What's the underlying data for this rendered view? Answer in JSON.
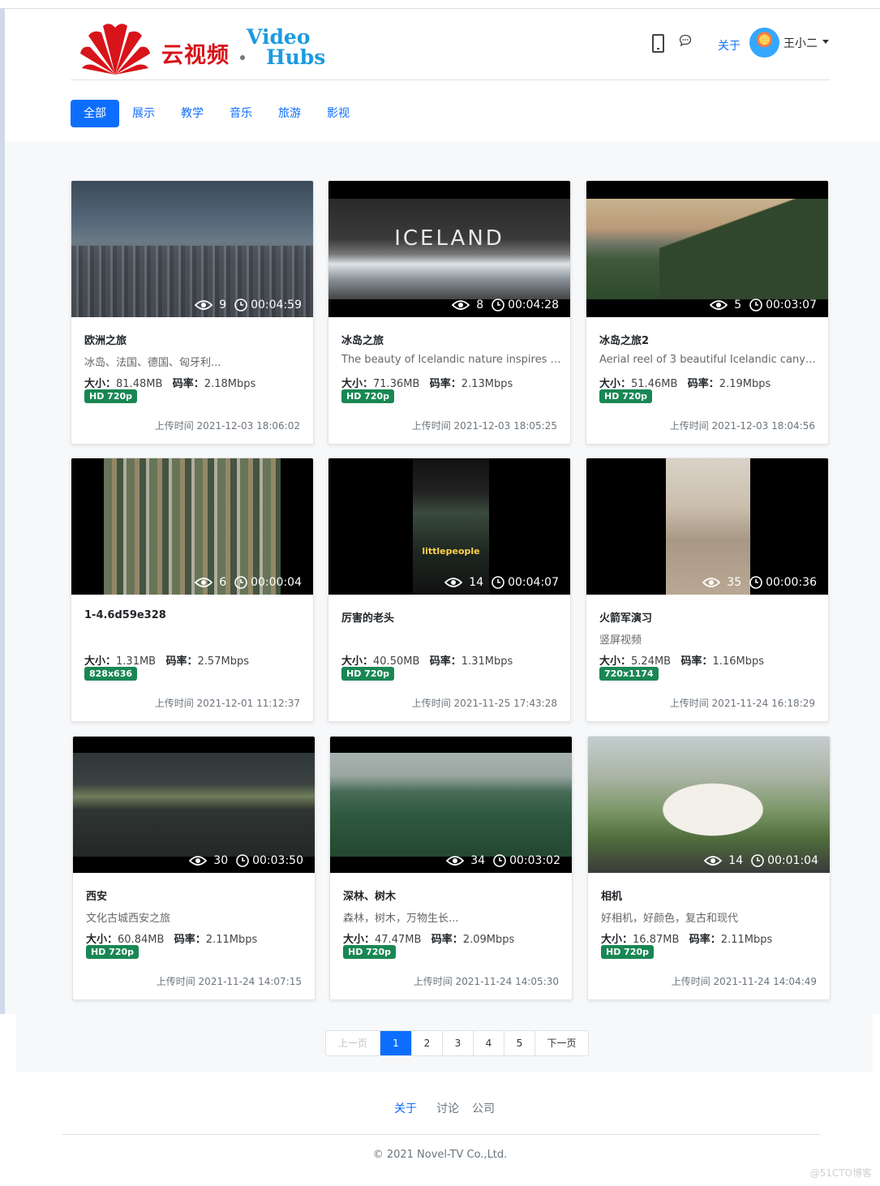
{
  "header": {
    "logo_cn": "云视频",
    "logo_en_line1": "Video",
    "logo_en_line2": "Hubs",
    "about_label": "关于",
    "user_name": "王小二"
  },
  "tabs": [
    {
      "label": "全部",
      "active": true
    },
    {
      "label": "展示"
    },
    {
      "label": "教学"
    },
    {
      "label": "音乐"
    },
    {
      "label": "旅游"
    },
    {
      "label": "影视"
    }
  ],
  "size_label": "大小：",
  "bitrate_label": "码率：",
  "upload_prefix": "上传时间",
  "videos": [
    {
      "title": "欧洲之旅",
      "desc": "冰岛、法国、德国、匈牙利...",
      "views": "9",
      "duration": "00:04:59",
      "size": "81.48MB",
      "bitrate": "2.18Mbps",
      "resolution": "HD 720p",
      "uploaded": "2021-12-03 18:06:02"
    },
    {
      "title": "冰岛之旅",
      "desc": "The beauty of Icelandic nature inspires c...",
      "views": "8",
      "duration": "00:04:28",
      "size": "71.36MB",
      "bitrate": "2.13Mbps",
      "resolution": "HD 720p",
      "uploaded": "2021-12-03 18:05:25",
      "thumb_text": "ICELAND"
    },
    {
      "title": "冰岛之旅2",
      "desc": "Aerial reel of 3 beautiful Icelandic canyons.",
      "views": "5",
      "duration": "00:03:07",
      "size": "51.46MB",
      "bitrate": "2.19Mbps",
      "resolution": "HD 720p",
      "uploaded": "2021-12-03 18:04:56"
    },
    {
      "title": "1-4.6d59e328",
      "desc": "",
      "views": "6",
      "duration": "00:00:04",
      "size": "1.31MB",
      "bitrate": "2.57Mbps",
      "resolution": "828x636",
      "uploaded": "2021-12-01 11:12:37"
    },
    {
      "title": "厉害的老头",
      "desc": "",
      "views": "14",
      "duration": "00:04:07",
      "size": "40.50MB",
      "bitrate": "1.31Mbps",
      "resolution": "HD 720p",
      "uploaded": "2021-11-25 17:43:28",
      "thumb_text": "littlepeople"
    },
    {
      "title": "火箭军演习",
      "desc": "竖屏视频",
      "views": "35",
      "duration": "00:00:36",
      "size": "5.24MB",
      "bitrate": "1.16Mbps",
      "resolution": "720x1174",
      "uploaded": "2021-11-24 16:18:29"
    },
    {
      "title": "西安",
      "desc": "文化古城西安之旅",
      "views": "30",
      "duration": "00:03:50",
      "size": "60.84MB",
      "bitrate": "2.11Mbps",
      "resolution": "HD 720p",
      "uploaded": "2021-11-24 14:07:15"
    },
    {
      "title": "深林、树木",
      "desc": "森林，树木，万物生长...",
      "views": "34",
      "duration": "00:03:02",
      "size": "47.47MB",
      "bitrate": "2.09Mbps",
      "resolution": "HD 720p",
      "uploaded": "2021-11-24 14:05:30"
    },
    {
      "title": "相机",
      "desc": "好相机，好颜色，复古和现代",
      "views": "14",
      "duration": "00:01:04",
      "size": "16.87MB",
      "bitrate": "2.11Mbps",
      "resolution": "HD 720p",
      "uploaded": "2021-11-24 14:04:49"
    }
  ],
  "pagination": {
    "prev": "上一页",
    "pages": [
      "1",
      "2",
      "3",
      "4",
      "5"
    ],
    "current": "1",
    "next": "下一页"
  },
  "footer": {
    "links": [
      "关于",
      "讨论",
      "公司"
    ],
    "copyright": "© 2021  Novel-TV Co.,Ltd.",
    "watermark": "@51CTO博客"
  },
  "colors": {
    "primary": "#0d6efd",
    "badge": "#198754",
    "brand_red": "#d7141a",
    "brand_blue": "#1a9be0"
  }
}
